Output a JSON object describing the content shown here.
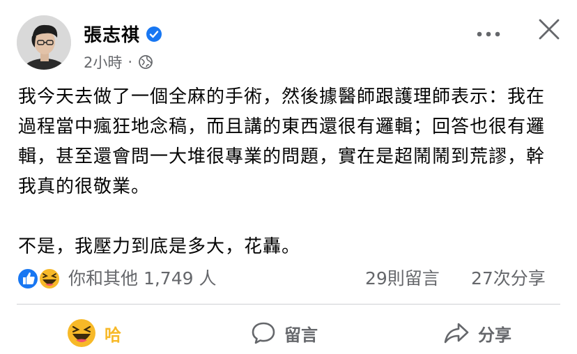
{
  "post": {
    "author": "張志祺",
    "time": "2小時",
    "separator": "·",
    "paragraphs": [
      "我今天去做了一個全麻的手術，然後據醫師跟護理師表示：我在過程當中瘋狂地念稿，而且講的東西還很有邏輯；回答也很有邏輯，甚至還會問一大堆很專業的問題，實在是超鬧鬧到荒謬，幹我真的很敬業。",
      "不是，我壓力到底是多大，花轟。"
    ]
  },
  "stats": {
    "reactions": "你和其他 1,749 人",
    "comments": "29則留言",
    "shares": "27次分享"
  },
  "actions": {
    "reaction": "哈",
    "comment": "留言",
    "share": "分享"
  },
  "icons": [
    "avatar",
    "verified-badge-icon",
    "globe-icon",
    "more-icon",
    "close-icon",
    "like-reaction-icon",
    "haha-reaction-icon",
    "comment-icon",
    "share-icon"
  ],
  "colors": {
    "verified": "#1877f2",
    "like": "#1877f2",
    "haha": "#f7b928",
    "muted": "#65676b"
  }
}
